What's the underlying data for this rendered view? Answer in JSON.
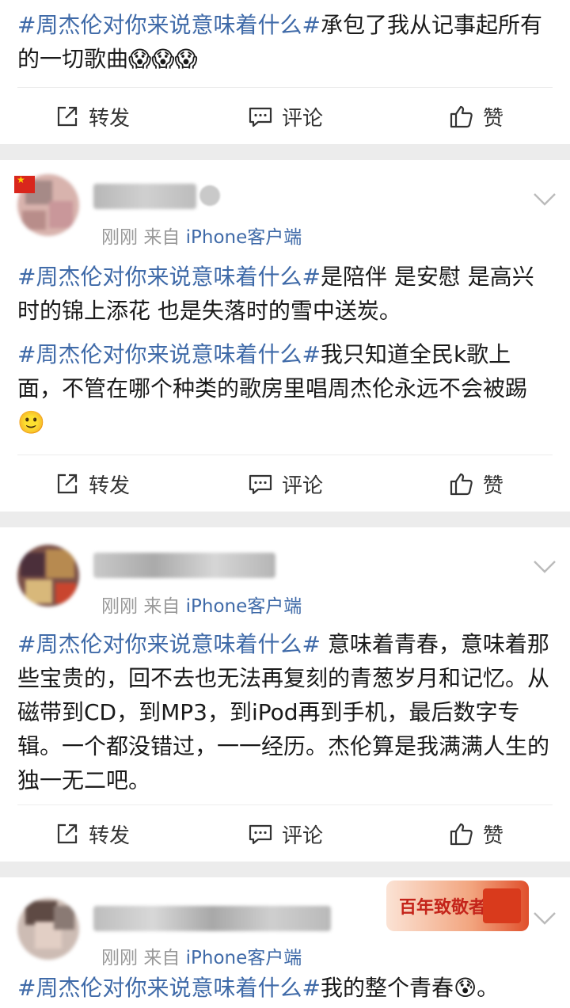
{
  "colors": {
    "hashtag": "#3f6aa8",
    "background": "#ececec",
    "card": "#ffffff",
    "meta": "#999999"
  },
  "hashtag": "#周杰伦对你来说意味着什么#",
  "posts": [
    {
      "paragraphs": [
        {
          "text": "承包了我从记事起所有的一切歌曲",
          "emoji": "😱😱😱"
        }
      ],
      "actions": {
        "repost": "转发",
        "comment": "评论",
        "like": "赞"
      }
    },
    {
      "time": "刚刚",
      "source_prefix": "来自",
      "client": "iPhone客户端",
      "paragraphs": [
        {
          "text": "是陪伴 是安慰  是高兴时的锦上添花 也是失落时的雪中送炭。"
        },
        {
          "text": "我只知道全民k歌上面，不管在哪个种类的歌房里唱周杰伦永远不会被踢",
          "emoji": "🙂"
        }
      ],
      "actions": {
        "repost": "转发",
        "comment": "评论",
        "like": "赞"
      }
    },
    {
      "time": "刚刚",
      "source_prefix": "来自",
      "client": "iPhone客户端",
      "paragraphs": [
        {
          "text": " 意味着青春，意味着那些宝贵的，回不去也无法再复刻的青葱岁月和记忆。从磁带到CD，到MP3，到iPod再到手机，最后数字专辑。一个都没错过，一一经历。杰伦算是我满满人生的独一无二吧。"
        }
      ],
      "actions": {
        "repost": "转发",
        "comment": "评论",
        "like": "赞"
      }
    },
    {
      "time": "刚刚",
      "source_prefix": "来自",
      "client": "iPhone客户端",
      "badge": "百年致敬者",
      "paragraphs": [
        {
          "text": "我的整个青春",
          "emoji": "😰",
          "tail": "。"
        }
      ]
    }
  ]
}
